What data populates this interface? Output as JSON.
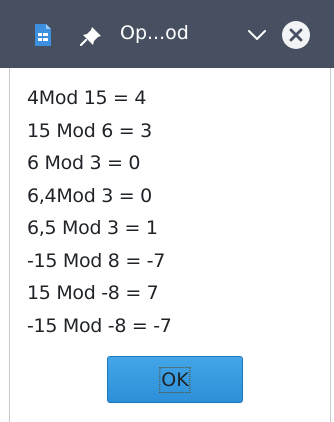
{
  "window": {
    "title": "Op...od"
  },
  "icons": {
    "app": "app-document-icon",
    "pin": "pin-icon",
    "minimize": "chevron-down-icon",
    "close": "close-icon"
  },
  "results": [
    "4Mod 15 = 4",
    "15 Mod 6 = 3",
    "6 Mod 3 = 0",
    "6,4Mod 3 = 0",
    "6,5 Mod 3 = 1",
    "-15 Mod 8 = -7",
    "15 Mod -8 = 7",
    "-15 Mod -8 = -7"
  ],
  "ok_button": {
    "label": "OK"
  },
  "colors": {
    "titlebar": "#465060",
    "button": "#3a9be0"
  }
}
